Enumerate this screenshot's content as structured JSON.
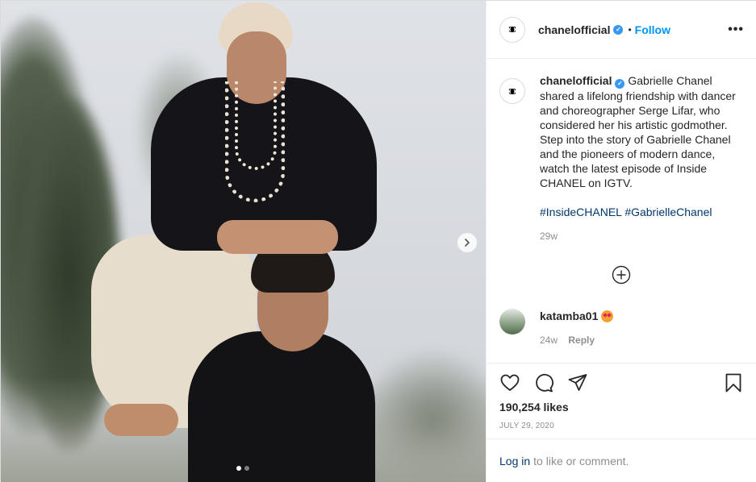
{
  "post": {
    "author": "chanelofficial",
    "verified": true,
    "verified_icon": "verified-badge-icon",
    "follow_label": "Follow",
    "separator": "•",
    "more_label": "•••",
    "logo_icon": "chanel-cc-logo"
  },
  "media": {
    "carousel_total": 2,
    "carousel_active": 1,
    "next_icon": "chevron-right-icon"
  },
  "caption": {
    "username": "chanelofficial",
    "text": "Gabrielle Chanel shared a lifelong friendship with dancer and choreographer Serge Lifar, who considered her his artistic godmother. Step into the story of Gabrielle Chanel and the pioneers of modern dance, watch the latest episode of Inside CHANEL on IGTV.",
    "hashtags": [
      "#InsideCHANEL",
      "#GabrielleChanel"
    ],
    "time": "29w"
  },
  "load_more_icon": "plus-circle-icon",
  "comment": {
    "username": "katamba01",
    "emoji": "heart-eyes-emoji",
    "time": "24w",
    "reply_label": "Reply"
  },
  "actions": {
    "icons": [
      "heart-icon",
      "comment-icon",
      "share-icon",
      "bookmark-icon"
    ]
  },
  "likes_text": "190,254 likes",
  "date_text": "JULY 29, 2020",
  "login": {
    "link_text": "Log in",
    "rest_text": "to like or comment."
  },
  "colors": {
    "link_blue": "#0095f6",
    "hashtag_blue": "#00376b",
    "muted_gray": "#8e8e8e",
    "text": "#262626",
    "border": "#efefef"
  }
}
